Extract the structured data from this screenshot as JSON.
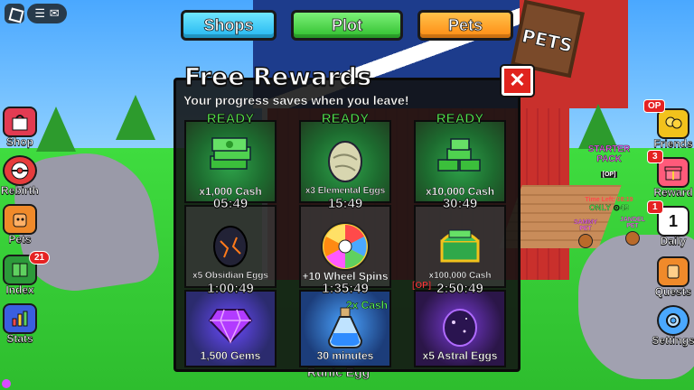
{
  "top_nav": {
    "shops": "Shops",
    "plot": "Plot",
    "pets": "Pets"
  },
  "world": {
    "sign_text": "PETS",
    "starter_pack": {
      "title": "STARTER PACK",
      "tag": "[OP]",
      "time": "Time Left: 08:19",
      "price": "ONLY ⊙49"
    },
    "pets": [
      {
        "name": "SAMMY PET"
      },
      {
        "name": "JANDEL PET"
      }
    ],
    "bottom_text": "Runic Egg"
  },
  "left_sidebar": [
    {
      "label": "Shop",
      "icon": "shopping-bag-icon"
    },
    {
      "label": "Rebirth",
      "icon": "rebirth-icon"
    },
    {
      "label": "Pets",
      "icon": "pet-icon"
    },
    {
      "label": "Index",
      "icon": "book-icon",
      "badge": "21"
    },
    {
      "label": "Stats",
      "icon": "chart-icon"
    }
  ],
  "right_sidebar": [
    {
      "label": "Friends",
      "icon": "friends-icon",
      "badge": "OP"
    },
    {
      "label": "Reward",
      "icon": "gift-icon",
      "badge": "3"
    },
    {
      "label": "Daily",
      "icon": "calendar-icon",
      "badge": "1",
      "day": "1"
    },
    {
      "label": "Quests",
      "icon": "scroll-icon"
    },
    {
      "label": "Settings",
      "icon": "gear-icon"
    }
  ],
  "panel": {
    "title": "Free Rewards",
    "subtitle": "Your progress saves when you leave!",
    "close_label": "✕",
    "rewards": [
      {
        "status": "READY",
        "label": "x1,000 Cash",
        "art": "cash-stack"
      },
      {
        "status": "READY",
        "label": "x3 Elemental Eggs",
        "art": "elemental-egg"
      },
      {
        "status": "READY",
        "label": "x10,000 Cash",
        "art": "cash-stack-large"
      },
      {
        "status": "05:49",
        "label": "x5 Obsidian Eggs",
        "art": "obsidian-egg"
      },
      {
        "status": "15:49",
        "label": "+10 Wheel Spins",
        "art": "spin-wheel"
      },
      {
        "status": "30:49",
        "label": "x100,000 Cash",
        "art": "cash-chest"
      },
      {
        "status": "1:00:49",
        "label": "1,500 Gems",
        "art": "gem"
      },
      {
        "status": "1:35:49",
        "label": "30 minutes",
        "art": "potion",
        "extra": "2x Cash"
      },
      {
        "status": "2:50:49",
        "label": "x5 Astral Eggs",
        "art": "astral-egg",
        "tag": "[OP]"
      }
    ]
  },
  "colors": {
    "shops": "#23b6f0",
    "plot": "#2fbf2d",
    "pets": "#ff8a12",
    "ready": "#53e24a",
    "close": "#e0241e"
  }
}
